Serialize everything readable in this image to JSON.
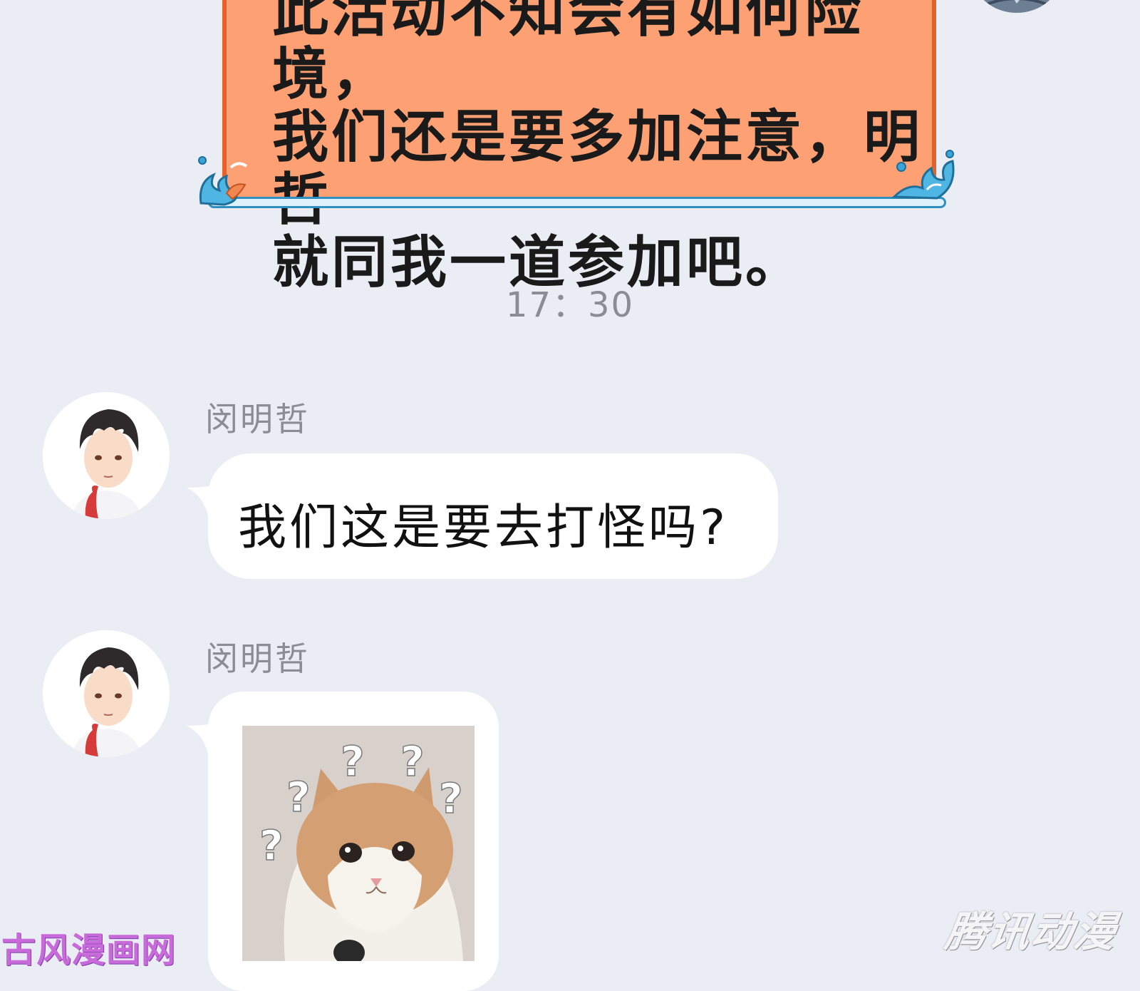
{
  "top_message": {
    "text_lines": [
      "此活动不知会有如何险境，",
      "我们还是要多加注意，明哲",
      "就同我一道参加吧。"
    ]
  },
  "timestamp": "17：30",
  "messages": [
    {
      "sender": "闵明哲",
      "text": "我们这是要去打怪吗?"
    },
    {
      "sender": "闵明哲",
      "sticker": "confused-cat-sticker"
    }
  ],
  "watermarks": {
    "left": "古风漫画网",
    "right": "腾讯动漫"
  },
  "colors": {
    "background": "#ebedf4",
    "orange_bubble": "#fda073",
    "orange_border": "#e3612a",
    "incoming_bubble": "#ffffff"
  }
}
